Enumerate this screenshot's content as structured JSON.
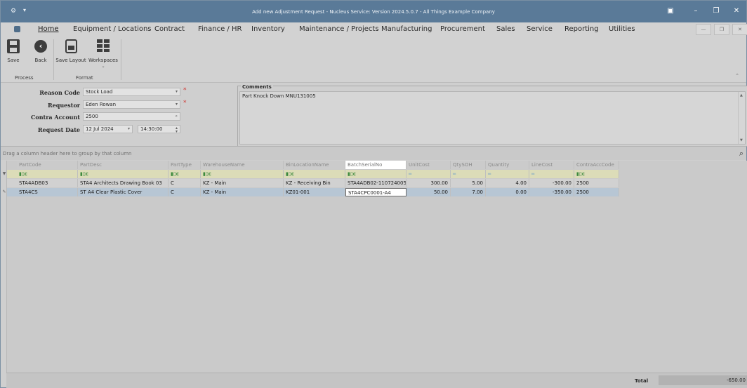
{
  "window": {
    "title": "Add new Adjustment Request - Nucleus Service: Version 2024.5.0.7 - All Things Example Company"
  },
  "menu": [
    "Home",
    "Equipment / Locations",
    "Contract",
    "Finance / HR",
    "Inventory",
    "Maintenance / Projects",
    "Manufacturing",
    "Procurement",
    "Sales",
    "Service",
    "Reporting",
    "Utilities"
  ],
  "ribbon": {
    "save_label": "Save",
    "back_label": "Back",
    "save_layout_label": "Save Layout",
    "workspaces_label": "Workspaces",
    "group_process": "Process",
    "group_format": "Format"
  },
  "form": {
    "reason_code_label": "Reason Code",
    "reason_code_value": "Stock Load",
    "requestor_label": "Requestor",
    "requestor_value": "Eden Rowan",
    "contra_account_label": "Contra Account",
    "contra_account_value": "2500",
    "request_date_label": "Request Date",
    "request_date_value": "12 Jul 2024",
    "request_time_value": "14:30:00",
    "comments_label": "Comments",
    "comments_value": "Part Knock Down MNU131005"
  },
  "grid": {
    "group_hint": "Drag a column header here to group by that column",
    "columns": [
      "PartCode",
      "PartDesc",
      "PartType",
      "WarehouseName",
      "BinLocationName",
      "BatchSerialNo",
      "UnitCost",
      "QtySOH",
      "Quantity",
      "LineCost",
      "ContraAccCode"
    ],
    "rows": [
      [
        "STA4ADB03",
        "STA4 Architects Drawing Book 03",
        "C",
        "KZ - Main",
        "KZ - Receiving Bin",
        "STA4ADB02-110724005",
        "300.00",
        "5.00",
        "4.00",
        "-300.00",
        "2500"
      ],
      [
        "STA4CS",
        "ST A4 Clear Plastic Cover",
        "C",
        "KZ - Main",
        "KZ01-001",
        "STA4CPC0001-A4",
        "50.00",
        "7.00",
        "0.00",
        "-350.00",
        "2500"
      ]
    ],
    "total_label": "Total",
    "total_value": "-650.00"
  }
}
